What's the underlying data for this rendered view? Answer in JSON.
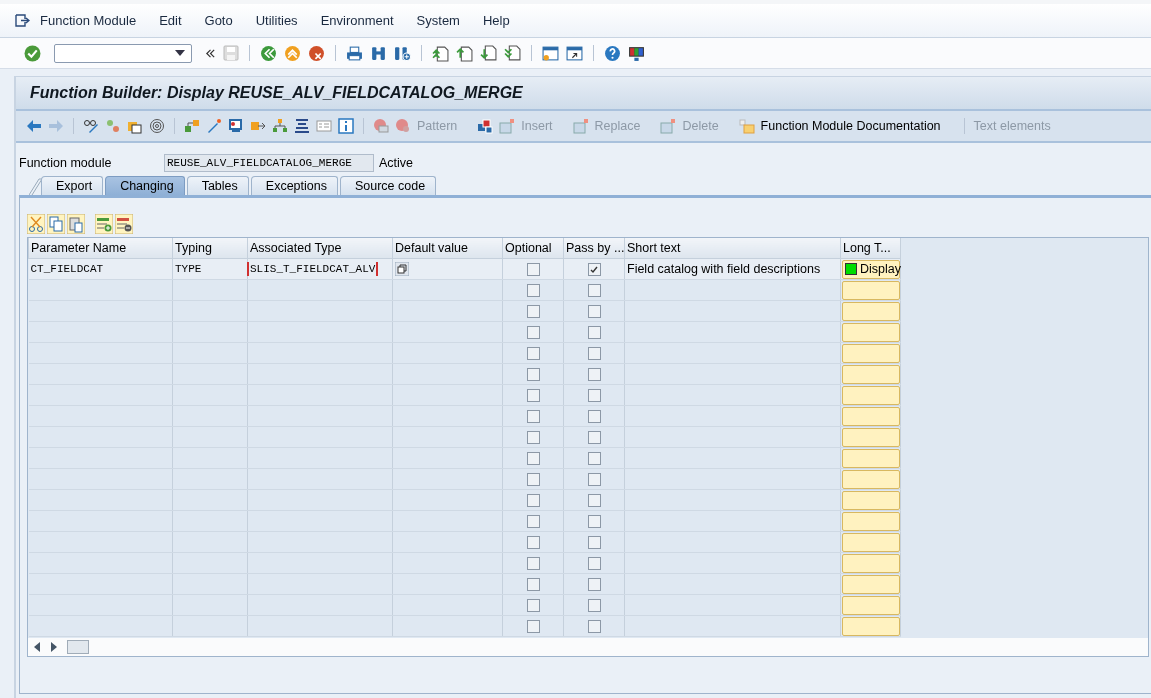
{
  "menu": [
    {
      "label": "Function Module"
    },
    {
      "label": "Edit"
    },
    {
      "label": "Goto"
    },
    {
      "label": "Utilities"
    },
    {
      "label": "Environment"
    },
    {
      "label": "System"
    },
    {
      "label": "Help"
    }
  ],
  "title": "Function Builder: Display REUSE_ALV_FIELDCATALOG_MERGE",
  "app_toolbar": [
    {
      "label": "Pattern",
      "disabled": true
    },
    {
      "label": "Insert",
      "disabled": true
    },
    {
      "label": "Replace",
      "disabled": true
    },
    {
      "label": "Delete",
      "disabled": true
    },
    {
      "label": "Function Module Documentation",
      "disabled": false
    },
    {
      "label": "Text elements",
      "disabled": true
    }
  ],
  "header": {
    "label": "Function module",
    "value": "REUSE_ALV_FIELDCATALOG_MERGE",
    "status": "Active"
  },
  "tabs": [
    {
      "label": "Export",
      "selected": false
    },
    {
      "label": "Changing",
      "selected": true
    },
    {
      "label": "Tables",
      "selected": false
    },
    {
      "label": "Exceptions",
      "selected": false
    },
    {
      "label": "Source code",
      "selected": false
    }
  ],
  "table": {
    "columns": [
      "Parameter Name",
      "Typing",
      "Associated Type",
      "Default value",
      "Optional",
      "Pass by ...",
      "Short text",
      "Long T..."
    ],
    "rows": [
      {
        "name": "CT_FIELDCAT",
        "typing": "TYPE",
        "associated_type": "SLIS_T_FIELDCAT_ALV",
        "optional": false,
        "pass_by_value": true,
        "short_text": "Field catalog with field descriptions",
        "long_text": "Display",
        "documented": true
      },
      {
        "optional": false,
        "pass_by_value": false
      },
      {
        "optional": false,
        "pass_by_value": false
      },
      {
        "optional": false,
        "pass_by_value": false
      },
      {
        "optional": false,
        "pass_by_value": false
      },
      {
        "optional": false,
        "pass_by_value": false
      },
      {
        "optional": false,
        "pass_by_value": false
      },
      {
        "optional": false,
        "pass_by_value": false
      },
      {
        "optional": false,
        "pass_by_value": false
      },
      {
        "optional": false,
        "pass_by_value": false
      },
      {
        "optional": false,
        "pass_by_value": false
      },
      {
        "optional": false,
        "pass_by_value": false
      },
      {
        "optional": false,
        "pass_by_value": false
      },
      {
        "optional": false,
        "pass_by_value": false
      },
      {
        "optional": false,
        "pass_by_value": false
      },
      {
        "optional": false,
        "pass_by_value": false
      },
      {
        "optional": false,
        "pass_by_value": false
      },
      {
        "optional": false,
        "pass_by_value": false
      }
    ]
  }
}
